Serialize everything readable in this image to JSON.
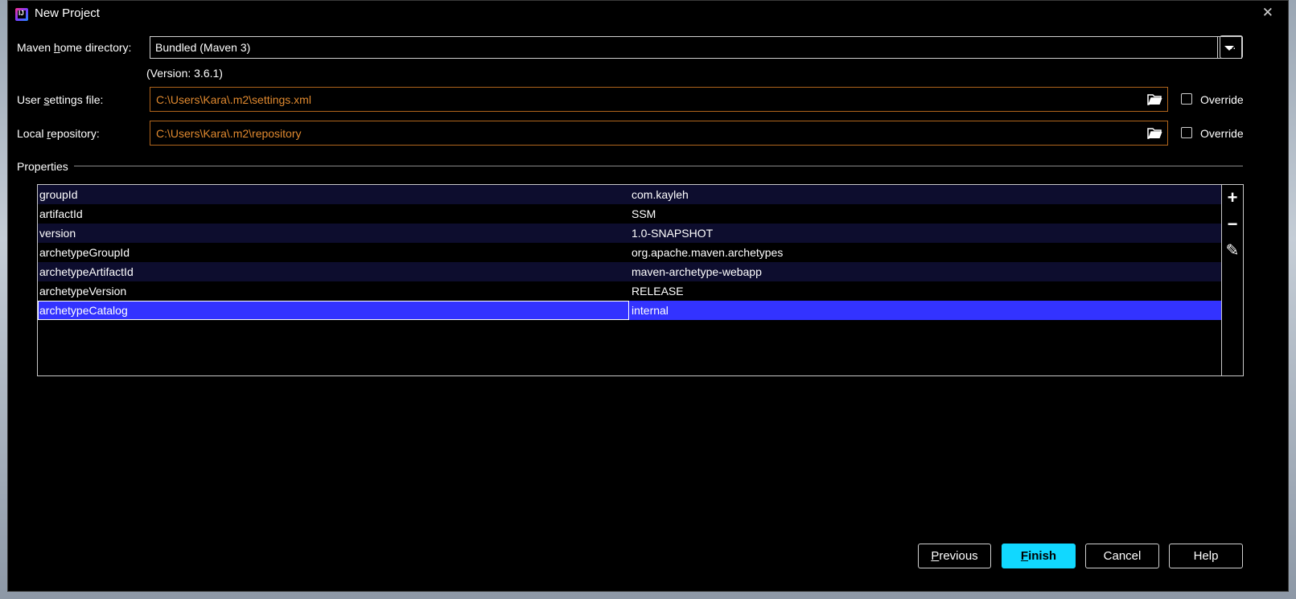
{
  "window": {
    "title": "New Project",
    "close_glyph": "✕"
  },
  "maven_home": {
    "label_pre": "Maven ",
    "label_mnemonic": "h",
    "label_post": "ome directory:",
    "value": "Bundled (Maven 3)",
    "browse_label": "...",
    "version_text": "(Version: 3.6.1)"
  },
  "user_settings": {
    "label_pre": "User ",
    "label_mnemonic": "s",
    "label_post": "ettings file:",
    "value": "C:\\Users\\Kara\\.m2\\settings.xml",
    "override_label": "Override",
    "override_checked": false
  },
  "local_repo": {
    "label_pre": "Local ",
    "label_mnemonic": "r",
    "label_post": "epository:",
    "value": "C:\\Users\\Kara\\.m2\\repository",
    "override_label": "Override",
    "override_checked": false
  },
  "properties": {
    "title": "Properties",
    "rows": [
      {
        "key": "groupId",
        "value": "com.kayleh"
      },
      {
        "key": "artifactId",
        "value": "SSM"
      },
      {
        "key": "version",
        "value": "1.0-SNAPSHOT"
      },
      {
        "key": "archetypeGroupId",
        "value": "org.apache.maven.archetypes"
      },
      {
        "key": "archetypeArtifactId",
        "value": "maven-archetype-webapp"
      },
      {
        "key": "archetypeVersion",
        "value": "RELEASE"
      },
      {
        "key": "archetypeCatalog",
        "value": "internal"
      }
    ],
    "selected_index": 6,
    "toolbar": {
      "add_glyph": "+",
      "remove_glyph": "−",
      "edit_glyph": "✎"
    }
  },
  "buttons": {
    "previous": {
      "mnemonic": "P",
      "rest": "revious"
    },
    "finish": {
      "mnemonic": "F",
      "rest": "inish"
    },
    "cancel": "Cancel",
    "help": "Help"
  },
  "colors": {
    "accent": "#11d8ff",
    "selection": "#3333ff",
    "path_text": "#e0892f",
    "row_alt": "#0d0d2e"
  },
  "icons": [
    "intellij-app-icon",
    "close-icon",
    "dropdown-arrow-icon",
    "folder-open-icon",
    "add-icon",
    "remove-icon",
    "edit-icon"
  ]
}
